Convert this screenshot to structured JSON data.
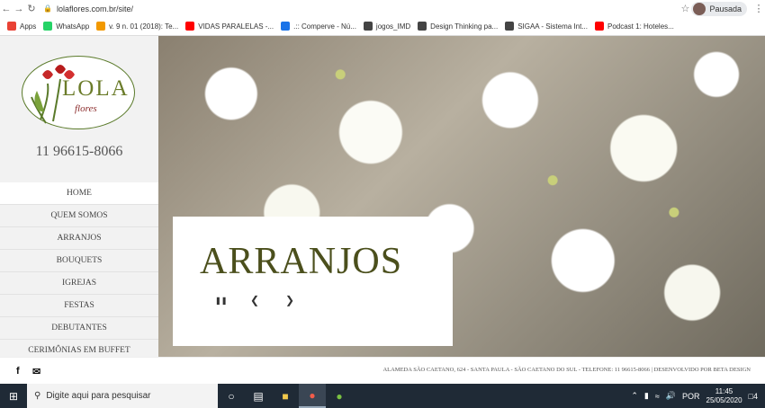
{
  "browser": {
    "back_icon": "arrow-left-icon",
    "forward_icon": "arrow-right-icon",
    "reload_icon": "reload-icon",
    "url": "lolaflores.com.br/site/",
    "profile_label": "Pausada"
  },
  "bookmarks": [
    {
      "label": "Apps",
      "color": "#e94235"
    },
    {
      "label": "WhatsApp",
      "color": "#25d366"
    },
    {
      "label": "v. 9 n. 01 (2018): Te...",
      "color": "#f29900"
    },
    {
      "label": "VIDAS PARALELAS -...",
      "color": "#ff0000"
    },
    {
      "label": ".:: Comperve - Nú...",
      "color": "#1a73e8"
    },
    {
      "label": "jogos_IMD",
      "color": "#444444"
    },
    {
      "label": "Design Thinking pa...",
      "color": "#444444"
    },
    {
      "label": "SIGAA - Sistema Int...",
      "color": "#444444"
    },
    {
      "label": "Podcast 1: Hoteles...",
      "color": "#ff0000"
    }
  ],
  "sidebar": {
    "logo_text": "LOLA",
    "logo_sub": "flores",
    "phone": "11 96615-8066",
    "menu": [
      {
        "label": "HOME"
      },
      {
        "label": "QUEM SOMOS"
      },
      {
        "label": "ARRANJOS"
      },
      {
        "label": "BOUQUETS"
      },
      {
        "label": "IGREJAS"
      },
      {
        "label": "FESTAS"
      },
      {
        "label": "DEBUTANTES"
      },
      {
        "label": "CERIMÔNIAS EM BUFFET"
      }
    ],
    "active_item": "HOME"
  },
  "hero": {
    "caption_title": "ARRANJOS",
    "pause_icon": "pause-icon",
    "prev_icon": "chevron-left-icon",
    "next_icon": "chevron-right-icon"
  },
  "footer": {
    "social_icons": [
      "facebook-icon",
      "email-icon"
    ],
    "text": "ALAMEDA SÃO CAETANO, 624 - SANTA PAULA - SÃO CAETANO DO SUL - TELEFONE: 11 96615-8066 | DESENVOLVIDO POR BETA DESIGN"
  },
  "taskbar": {
    "search_placeholder": "Digite aqui para pesquisar",
    "language": "POR",
    "time": "11:45",
    "date": "25/05/2020",
    "notifications": "4"
  }
}
